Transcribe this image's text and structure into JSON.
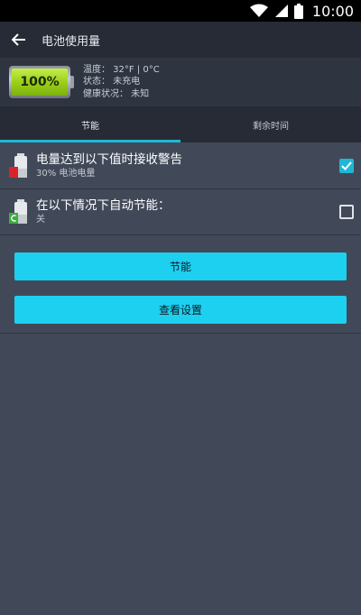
{
  "status_bar": {
    "time": "10:00"
  },
  "app_bar": {
    "title": "电池使用量"
  },
  "battery": {
    "percent_label": "100%",
    "level": 1.0
  },
  "info": {
    "temperature": "温度： 32°F | 0°C",
    "state": "状态： 未充电",
    "health": "健康状况： 未知"
  },
  "tabs": [
    {
      "label": "节能",
      "selected": true
    },
    {
      "label": "剩余时间",
      "selected": false
    }
  ],
  "settings": [
    {
      "title": "电量达到以下值时接收警告",
      "subtitle": "30% 电池电量",
      "checked": true
    },
    {
      "title": "在以下情况下自动节能：",
      "subtitle": "关",
      "checked": false
    }
  ],
  "buttons": {
    "save_power": "节能",
    "view_settings": "查看设置"
  },
  "colors": {
    "accent": "#21b6d6",
    "button": "#1ed0f0",
    "background": "#414959"
  }
}
